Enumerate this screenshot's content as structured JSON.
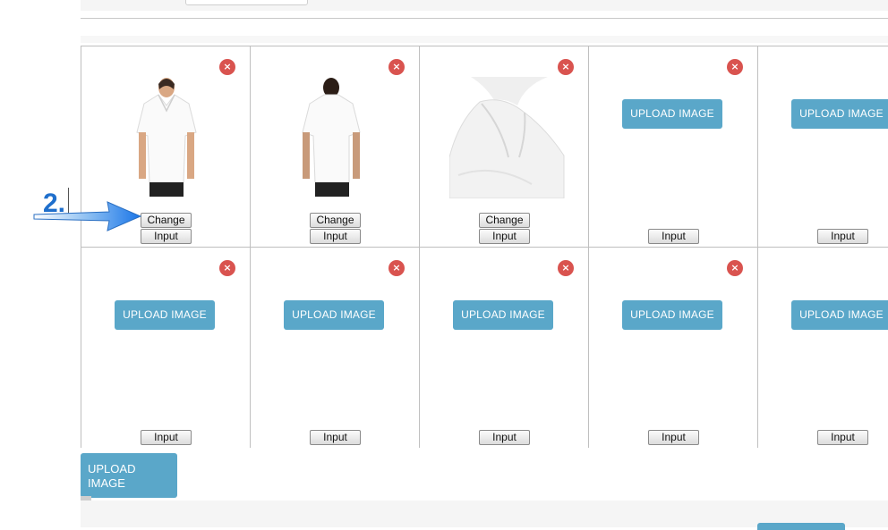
{
  "top": {
    "search_value": ""
  },
  "annotation": {
    "step_label": "2."
  },
  "labels": {
    "upload": "UPLOAD IMAGE",
    "change": "Change",
    "input": "Input",
    "remove": "×"
  },
  "rows": [
    [
      {
        "image": "shirt-front",
        "has_change": true
      },
      {
        "image": "shirt-back",
        "has_change": true
      },
      {
        "image": "shirt-collar",
        "has_change": true
      },
      {
        "image": null,
        "has_change": false
      },
      {
        "image": null,
        "has_change": false
      }
    ],
    [
      {
        "image": null,
        "has_change": false
      },
      {
        "image": null,
        "has_change": false
      },
      {
        "image": null,
        "has_change": false
      },
      {
        "image": null,
        "has_change": false
      },
      {
        "image": null,
        "has_change": false
      }
    ]
  ],
  "bottom": {
    "upload_label": "UPLOAD IMAGE"
  },
  "colors": {
    "accent": "#5aa7c9",
    "remove": "#d9534f",
    "annotation": "#1f6fcc"
  }
}
